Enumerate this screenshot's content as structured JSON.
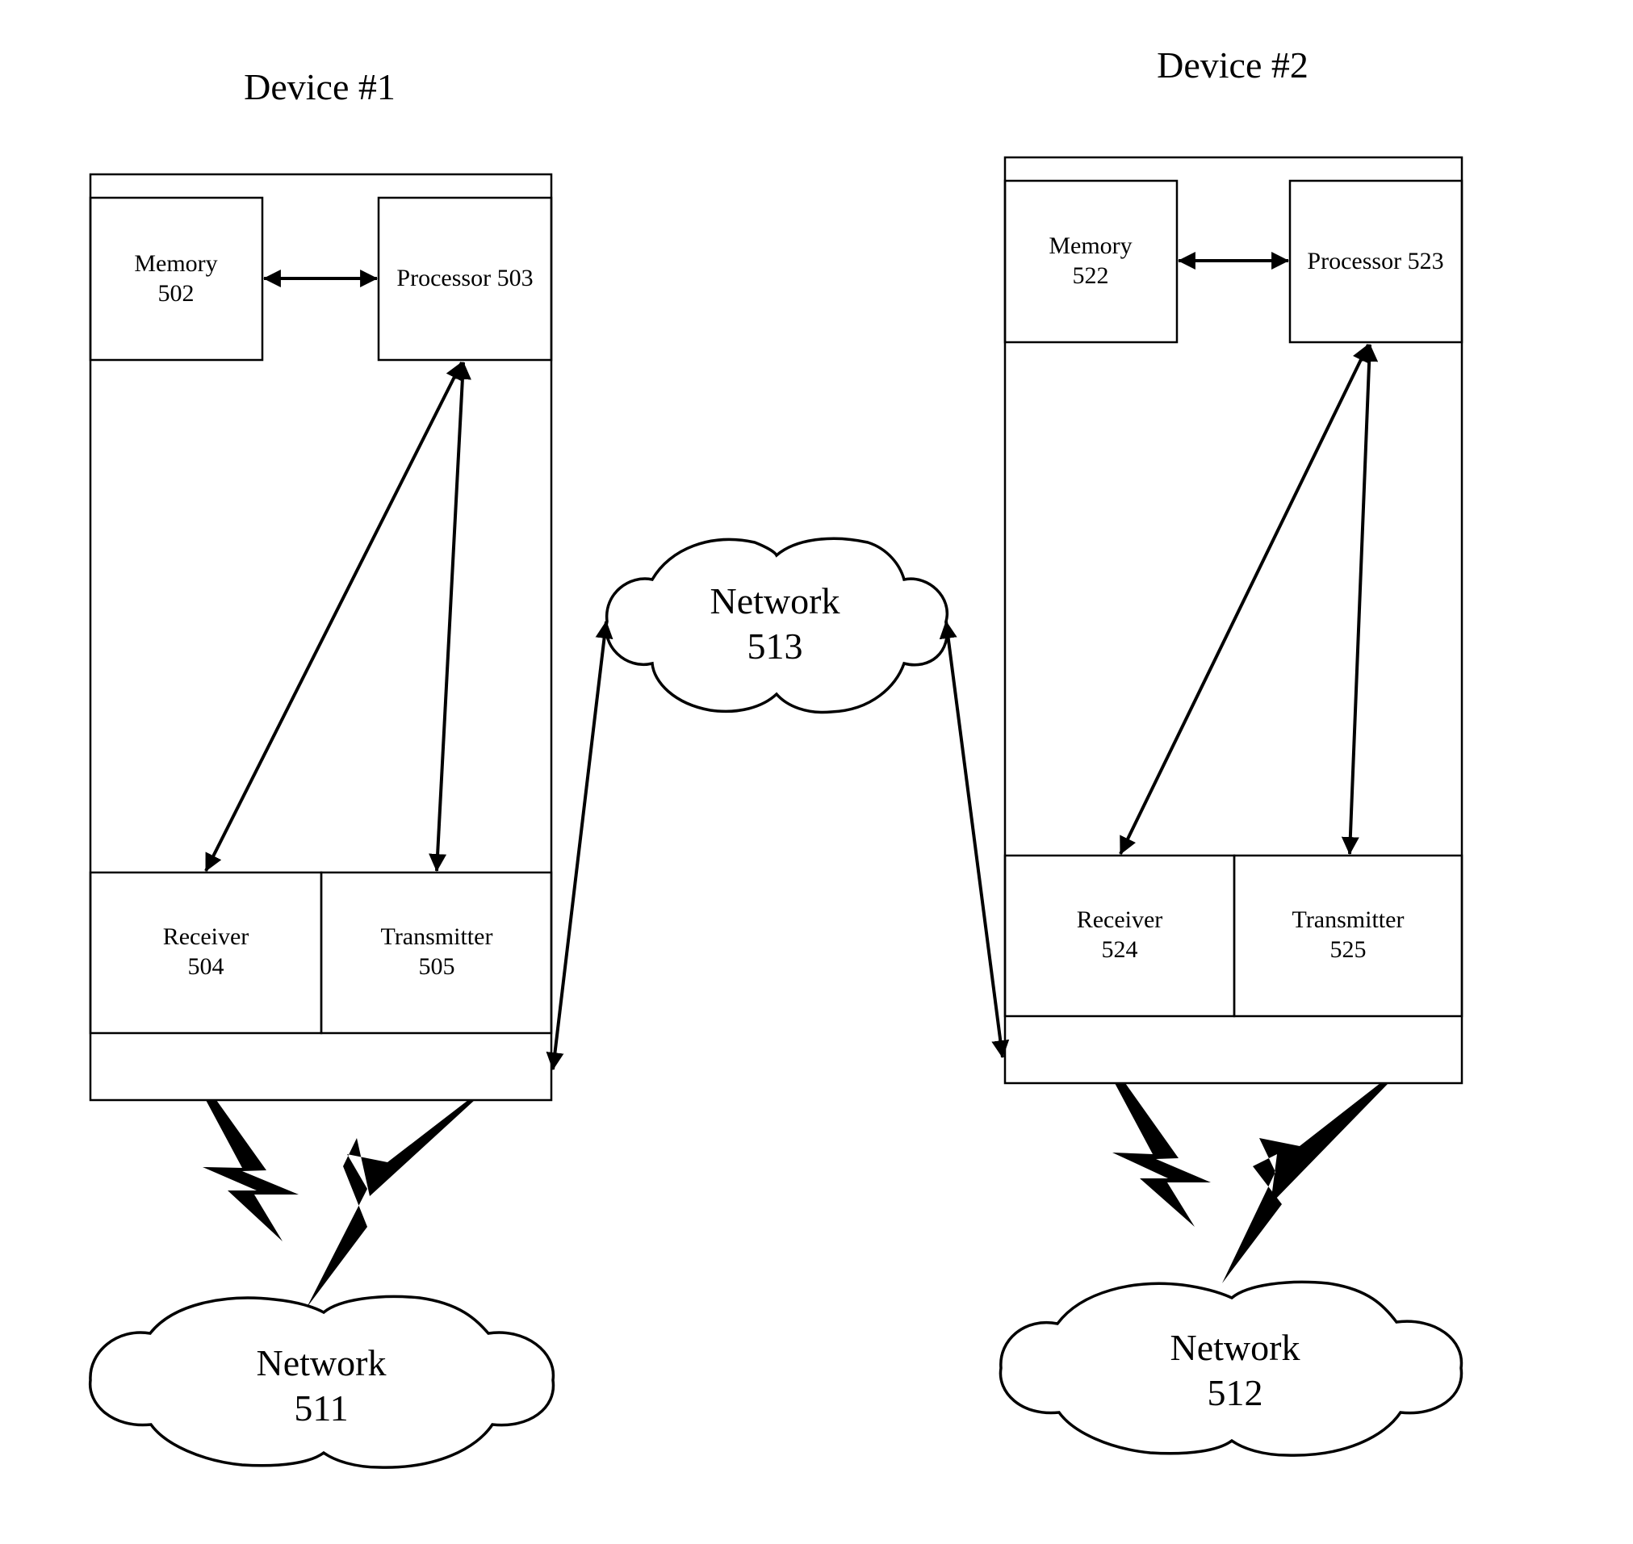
{
  "diagram": {
    "device1": {
      "title": "Device #1",
      "memory": {
        "line1": "Memory",
        "line2": "502"
      },
      "processor": {
        "line1": "Processor 503"
      },
      "receiver": {
        "line1": "Receiver",
        "line2": "504"
      },
      "transmitter": {
        "line1": "Transmitter",
        "line2": "505"
      }
    },
    "device2": {
      "title": "Device #2",
      "memory": {
        "line1": "Memory",
        "line2": "522"
      },
      "processor": {
        "line1": "Processor 523"
      },
      "receiver": {
        "line1": "Receiver",
        "line2": "524"
      },
      "transmitter": {
        "line1": "Transmitter",
        "line2": "525"
      }
    },
    "networks": {
      "n511": {
        "line1": "Network",
        "line2": "511"
      },
      "n512": {
        "line1": "Network",
        "line2": "512"
      },
      "n513": {
        "line1": "Network",
        "line2": "513"
      }
    },
    "connections": [
      {
        "from": "Memory 502",
        "to": "Processor 503",
        "type": "bidirectional"
      },
      {
        "from": "Processor 503",
        "to": "Receiver 504",
        "type": "bidirectional"
      },
      {
        "from": "Processor 503",
        "to": "Transmitter 505",
        "type": "bidirectional"
      },
      {
        "from": "Device #1",
        "to": "Network 513",
        "type": "bidirectional"
      },
      {
        "from": "Device #1",
        "to": "Network 511",
        "type": "wireless"
      },
      {
        "from": "Memory 522",
        "to": "Processor 523",
        "type": "bidirectional"
      },
      {
        "from": "Processor 523",
        "to": "Receiver 524",
        "type": "bidirectional"
      },
      {
        "from": "Processor 523",
        "to": "Transmitter 525",
        "type": "bidirectional"
      },
      {
        "from": "Device #2",
        "to": "Network 513",
        "type": "bidirectional"
      },
      {
        "from": "Device #2",
        "to": "Network 512",
        "type": "wireless"
      }
    ]
  }
}
